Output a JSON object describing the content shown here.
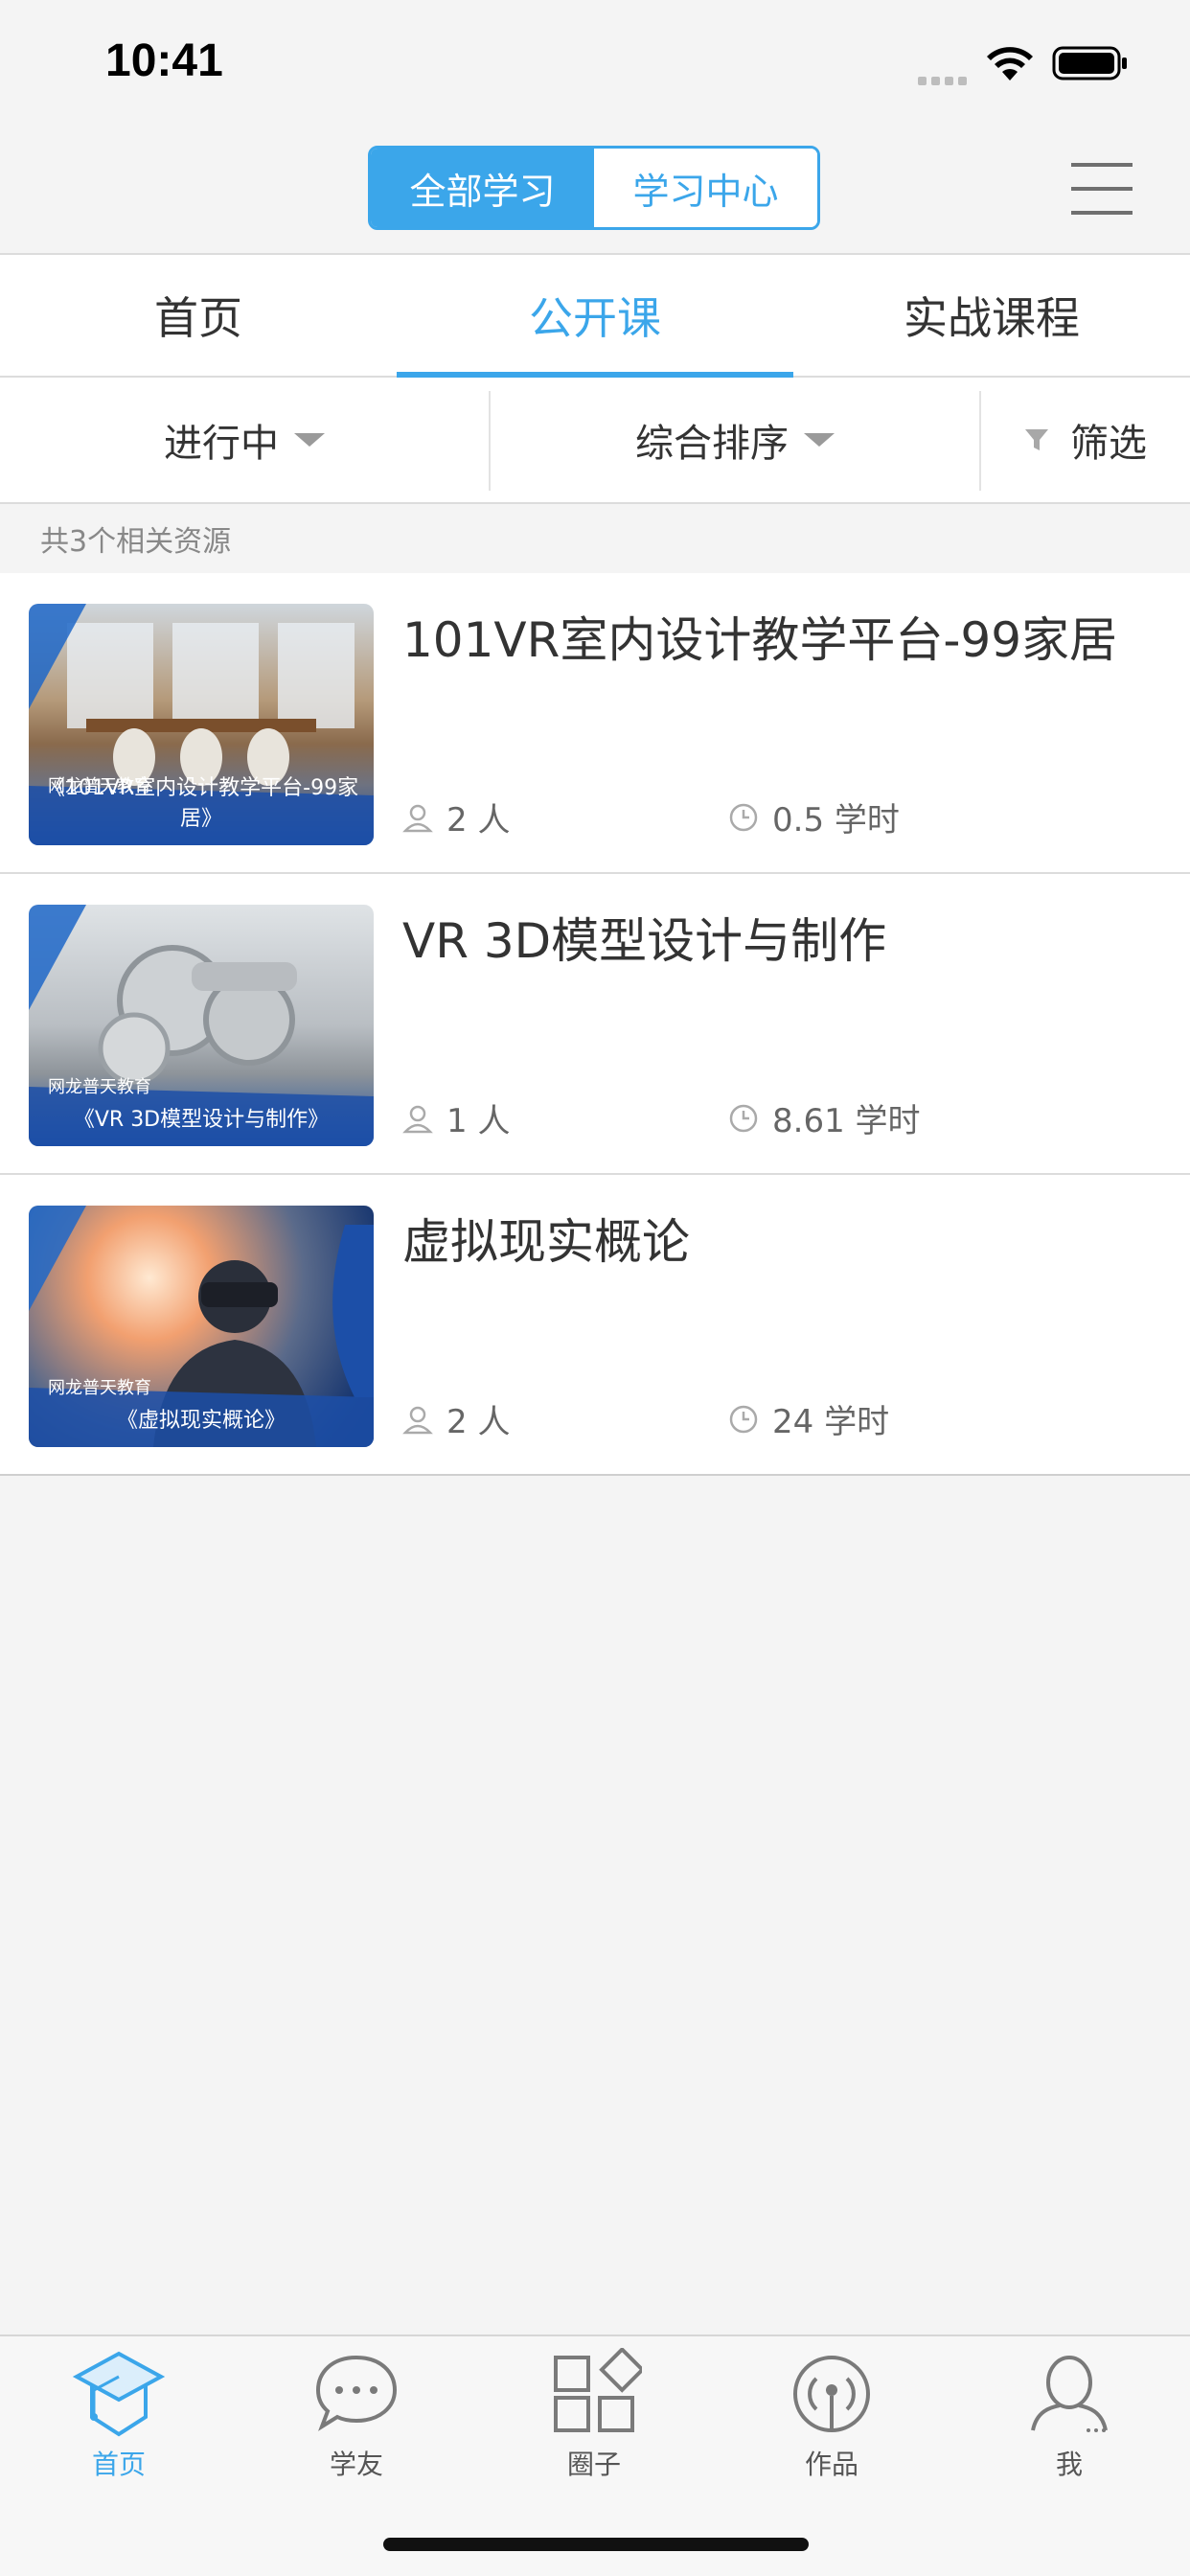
{
  "status_bar": {
    "time": "10:41"
  },
  "header": {
    "segment": [
      {
        "label": "全部学习",
        "active": true
      },
      {
        "label": "学习中心",
        "active": false
      }
    ]
  },
  "tabs": [
    {
      "label": "首页",
      "active": false
    },
    {
      "label": "公开课",
      "active": true
    },
    {
      "label": "实战课程",
      "active": false
    }
  ],
  "filters": {
    "status": "进行中",
    "sort": "综合排序",
    "filter": "筛选"
  },
  "result_count": "共3个相关资源",
  "courses": [
    {
      "title": "101VR室内设计教学平台-99家居",
      "caption": "《101VR室内设计教学平台-99家居》",
      "brand": "网龙普天教育",
      "people": "2 人",
      "hours": "0.5 学时"
    },
    {
      "title": "VR 3D模型设计与制作",
      "caption": "《VR  3D模型设计与制作》",
      "brand": "网龙普天教育",
      "people": "1 人",
      "hours": "8.61 学时"
    },
    {
      "title": "虚拟现实概论",
      "caption": "《虚拟现实概论》",
      "brand": "网龙普天教育",
      "people": "2 人",
      "hours": "24 学时"
    }
  ],
  "bottom_nav": [
    {
      "label": "首页",
      "icon": "graduation-cap-icon",
      "active": true
    },
    {
      "label": "学友",
      "icon": "chat-bubble-icon",
      "active": false
    },
    {
      "label": "圈子",
      "icon": "grid-squares-icon",
      "active": false
    },
    {
      "label": "作品",
      "icon": "broadcast-icon",
      "active": false
    },
    {
      "label": "我",
      "icon": "user-profile-icon",
      "active": false
    }
  ],
  "colors": {
    "accent": "#3ba6ea",
    "background": "#f4f4f4",
    "text": "#333333",
    "muted": "#888888"
  }
}
